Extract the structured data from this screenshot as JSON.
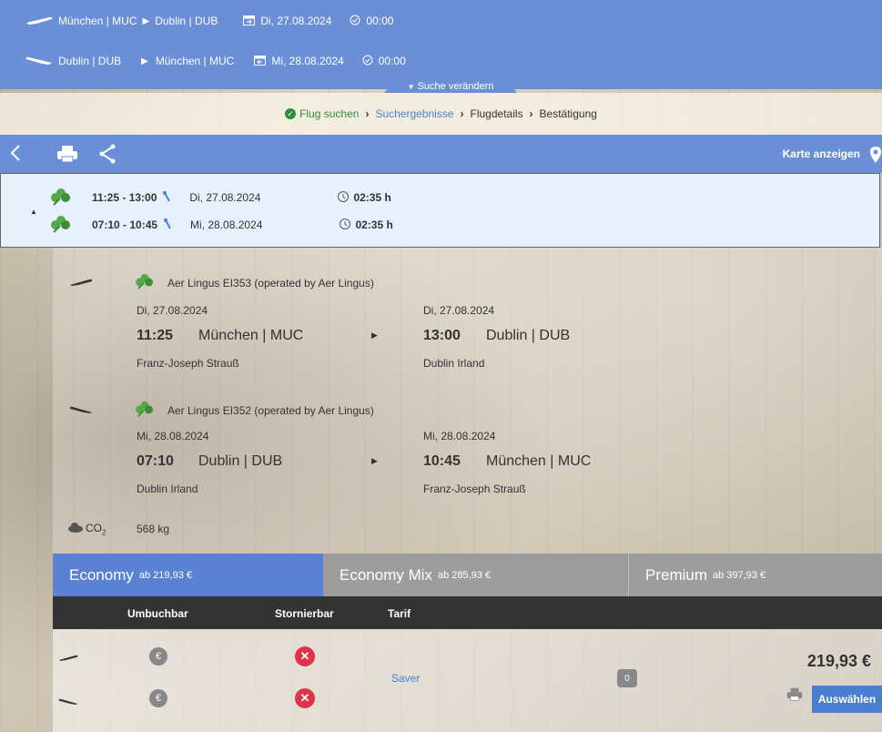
{
  "search": {
    "outbound": {
      "from": "München | MUC",
      "to": "Dublin | DUB",
      "date": "Di, 27.08.2024",
      "time": "00:00"
    },
    "inbound": {
      "from": "Dublin | DUB",
      "to": "München | MUC",
      "date": "Mi, 28.08.2024",
      "time": "00:00"
    },
    "change_label": "Suche verändern"
  },
  "steps": [
    "Flug suchen",
    "Suchergebnisse",
    "Flugdetails",
    "Bestätigung"
  ],
  "toolbar": {
    "map_label": "Karte anzeigen"
  },
  "summary": [
    {
      "times": "11:25 - 13:00",
      "date": "Di,  27.08.2024",
      "duration": "02:35 h"
    },
    {
      "times": "07:10 - 10:45",
      "date": "Mi,  28.08.2024",
      "duration": "02:35 h"
    }
  ],
  "flights": [
    {
      "airline": "Aer Lingus EI353 (operated by Aer Lingus)",
      "dep_date": "Di, 27.08.2024",
      "dep_time": "11:25",
      "dep_airport": "München | MUC",
      "dep_name": "Franz-Joseph Strauß",
      "arr_date": "Di, 27.08.2024",
      "arr_time": "13:00",
      "arr_airport": "Dublin | DUB",
      "arr_name": "Dublin Irland"
    },
    {
      "airline": "Aer Lingus EI352 (operated by Aer Lingus)",
      "dep_date": "Mi, 28.08.2024",
      "dep_time": "07:10",
      "dep_airport": "Dublin | DUB",
      "dep_name": "Dublin Irland",
      "arr_date": "Mi, 28.08.2024",
      "arr_time": "10:45",
      "arr_airport": "München | MUC",
      "arr_name": "Franz-Joseph Strauß"
    }
  ],
  "co2": {
    "label": "CO",
    "sub": "2",
    "value": "568 kg"
  },
  "fare_tabs": [
    {
      "name": "Economy",
      "from": "ab 219,93 €"
    },
    {
      "name": "Economy Mix",
      "from": "ab 285,93 €"
    },
    {
      "name": "Premium",
      "from": "ab 397,93 €"
    }
  ],
  "fare_headers": [
    "Umbuchbar",
    "Stornierbar",
    "Tarif"
  ],
  "fare": {
    "tarif": "Saver",
    "price": "219,93 €",
    "bags": "0",
    "euro_symbol": "€",
    "x_symbol": "✕",
    "select_label": "Auswählen"
  },
  "colors": {
    "primary": "#6b8fd6",
    "active_tab": "#5b82d2",
    "inactive_tab": "#9d9d9d",
    "header_dark": "#333333",
    "green": "#2e8b3b",
    "red": "#e0324b"
  }
}
